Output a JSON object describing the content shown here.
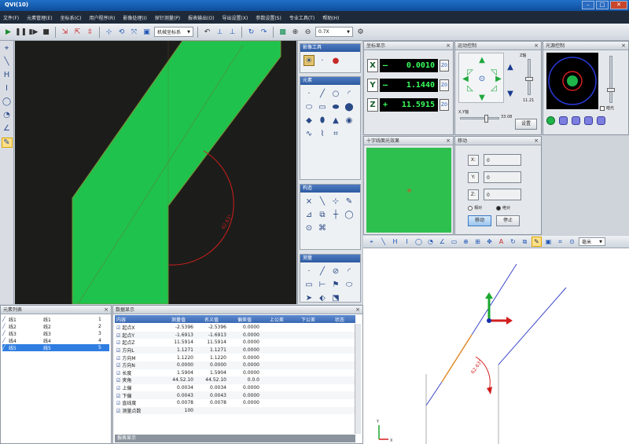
{
  "window": {
    "title": "QVI(10)",
    "buttons": [
      "–",
      "□",
      "✕"
    ]
  },
  "menu": [
    "文件(F)",
    "元素管理(E)",
    "坐标系(C)",
    "用户程序(R)",
    "影像处理(I)",
    "探针测量(P)",
    "报表输出(O)",
    "导出设置(X)",
    "参数设置(S)",
    "专业工具(T)",
    "帮助(H)"
  ],
  "toolbar": {
    "coord_select": "机械坐标系",
    "magnification": "0.7X"
  },
  "camera": {
    "dimension_label": "62.63°"
  },
  "dro": {
    "title": "坐标显示",
    "axes": [
      {
        "axis": "X",
        "sign": "–",
        "value": "0.0010",
        "zero": "Z0"
      },
      {
        "axis": "Y",
        "sign": "–",
        "value": "1.1440",
        "zero": "Z0"
      },
      {
        "axis": "Z",
        "sign": "+",
        "value": "11.5915",
        "zero": "Z0"
      }
    ]
  },
  "motion": {
    "title": "运动控制",
    "z_speed_label": "Z轴",
    "z_speed_value": "11.21",
    "xy_speed_label": "X,Y轴",
    "xy_speed_value": "33.08",
    "set_button": "设置"
  },
  "light": {
    "title": "光源控制",
    "check_label": "暗光"
  },
  "preview": {
    "title": "十字线面光效果"
  },
  "move": {
    "title": "移动",
    "x_label": "X:",
    "x_value": "0",
    "y_label": "Y:",
    "y_value": "0",
    "z_label": "Z:",
    "z_value": "0",
    "relative_label": "相对",
    "absolute_label": "绝对",
    "move_button": "移动",
    "stop_button": "停止"
  },
  "view3d": {
    "unit_select": "毫米",
    "dimension_label": "62.63°"
  },
  "tool_panel": {
    "groups": [
      {
        "title": "影像工具"
      },
      {
        "title": "元素"
      },
      {
        "title": "构造"
      },
      {
        "title": "测量"
      }
    ]
  },
  "element_list": {
    "title": "元素列表",
    "rows": [
      {
        "a": "线1",
        "b": "线1",
        "n": "1"
      },
      {
        "a": "线2",
        "b": "线2",
        "n": "2"
      },
      {
        "a": "线3",
        "b": "线3",
        "n": "3"
      },
      {
        "a": "线4",
        "b": "线4",
        "n": "4"
      },
      {
        "a": "线5",
        "b": "线5",
        "n": "5"
      }
    ]
  },
  "data_table": {
    "title": "数据显示",
    "columns": [
      "内容",
      "测量值",
      "名义值",
      "偏差值",
      "上公差",
      "下公差",
      "状态"
    ],
    "rows": [
      [
        "起点X",
        "-2.5396",
        "-2.5396",
        "0.0000"
      ],
      [
        "起点Y",
        "-1.6913",
        "-1.6913",
        "0.0000"
      ],
      [
        "起点Z",
        "11.5914",
        "11.5914",
        "0.0000"
      ],
      [
        "方向L",
        "1.1271",
        "1.1271",
        "0.0000"
      ],
      [
        "方向M",
        "1.1220",
        "1.1220",
        "0.0000"
      ],
      [
        "方向N",
        "0.0000",
        "0.0000",
        "0.0000"
      ],
      [
        "长度",
        "1.5904",
        "1.5904",
        "0.0000"
      ],
      [
        "夹角",
        "44.52.10",
        "44.52.10",
        "0.0.0"
      ],
      [
        "上偏",
        "0.0034",
        "0.0034",
        "0.0000"
      ],
      [
        "下偏",
        "0.0043",
        "0.0043",
        "0.0000"
      ],
      [
        "直线度",
        "0.0078",
        "0.0078",
        "0.0000"
      ],
      [
        "测量点数",
        "100",
        "",
        ""
      ]
    ],
    "footer": "报表显示"
  }
}
